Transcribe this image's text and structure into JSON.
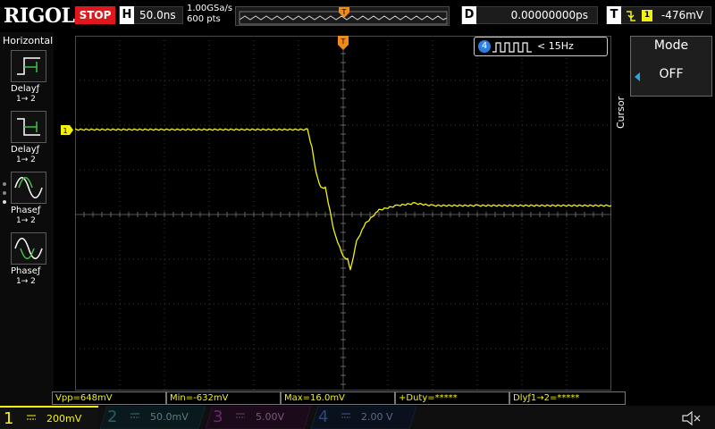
{
  "brand": "RIGOL",
  "run_state": "STOP",
  "horizontal": {
    "label": "H",
    "timebase": "50.0ns"
  },
  "acquisition": {
    "sample_rate": "1.00GSa/s",
    "memory_depth": "600 pts"
  },
  "delay": {
    "label": "D",
    "value": "0.00000000ps"
  },
  "trigger": {
    "label": "T",
    "source": "1",
    "level": "-476mV",
    "edge": "falling-edge-icon"
  },
  "left_menu": {
    "title": "Horizontal",
    "items": [
      {
        "name": "Delayƒ",
        "sub": "1→ 2",
        "icon": "delay-rise-icon"
      },
      {
        "name": "Delayƒ",
        "sub": "1→ 2",
        "icon": "delay-fall-icon"
      },
      {
        "name": "Phaseƒ",
        "sub": "1→ 2",
        "icon": "phase-rise-icon"
      },
      {
        "name": "Phaseƒ",
        "sub": "1→ 2",
        "icon": "phase-fall-icon"
      }
    ]
  },
  "counter": {
    "channel": "4",
    "value": "< 15Hz"
  },
  "right_menu": {
    "section": "Cursor",
    "mode_label": "Mode",
    "mode_value": "OFF"
  },
  "measurements": [
    "Vpp=648mV",
    "Min=-632mV",
    "Max=16.0mV",
    "+Duty=*****",
    "Dlyƒ1→2=*****"
  ],
  "channels": [
    {
      "num": "1",
      "scale": "200mV",
      "color": "#f3f30a",
      "active": true
    },
    {
      "num": "2",
      "scale": "50.0mV",
      "color": "#2fb7c8",
      "active": false
    },
    {
      "num": "3",
      "scale": "5.00V",
      "color": "#c42cc4",
      "active": false
    },
    {
      "num": "4",
      "scale": "2.00 V",
      "color": "#2a7fe0",
      "active": false
    }
  ],
  "colors": {
    "ch1": "#f3f30a",
    "stop": "#e0181d",
    "trigger_marker": "#f08a18",
    "accent": "#2ca6e0"
  },
  "waveform": {
    "channel": "1",
    "volts_per_div": 0.2,
    "seconds_per_div": 5e-08,
    "time_ns": [
      -300,
      -40,
      -35,
      -30,
      -25,
      -20,
      -15,
      -10,
      0,
      5,
      8,
      15,
      25,
      40,
      60,
      80,
      100,
      150,
      300
    ],
    "volts": [
      0.0,
      0.0,
      -0.08,
      -0.2,
      -0.26,
      -0.26,
      -0.36,
      -0.46,
      -0.57,
      -0.58,
      -0.63,
      -0.5,
      -0.42,
      -0.36,
      -0.34,
      -0.33,
      -0.34,
      -0.34,
      -0.34
    ]
  }
}
